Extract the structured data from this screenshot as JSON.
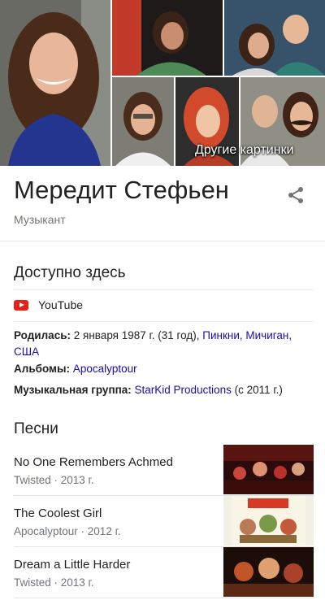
{
  "gallery": {
    "more_label": "Другие картинки"
  },
  "entity": {
    "name": "Мередит Стефьен",
    "type": "Музыкант"
  },
  "available": {
    "heading": "Доступно здесь",
    "provider": "YouTube"
  },
  "facts": {
    "born_label": "Родилась:",
    "born_text": "2 января 1987 г. (31 год),",
    "born_link": "Пинкни, Мичиган, США",
    "albums_label": "Альбомы:",
    "albums_link": "Apocalyptour",
    "band_label": "Музыкальная группа:",
    "band_link": "StarKid Productions",
    "band_suffix": "(с 2011 г.)"
  },
  "songs": {
    "heading": "Песни",
    "items": [
      {
        "title": "No One Remembers Achmed",
        "meta": "Twisted · 2013 г."
      },
      {
        "title": "The Coolest Girl",
        "meta": "Apocalyptour · 2012 г."
      },
      {
        "title": "Dream a Little Harder",
        "meta": "Twisted · 2013 г."
      }
    ]
  },
  "colors": {
    "accent_link": "#1a0dab",
    "youtube_red": "#e62117"
  }
}
